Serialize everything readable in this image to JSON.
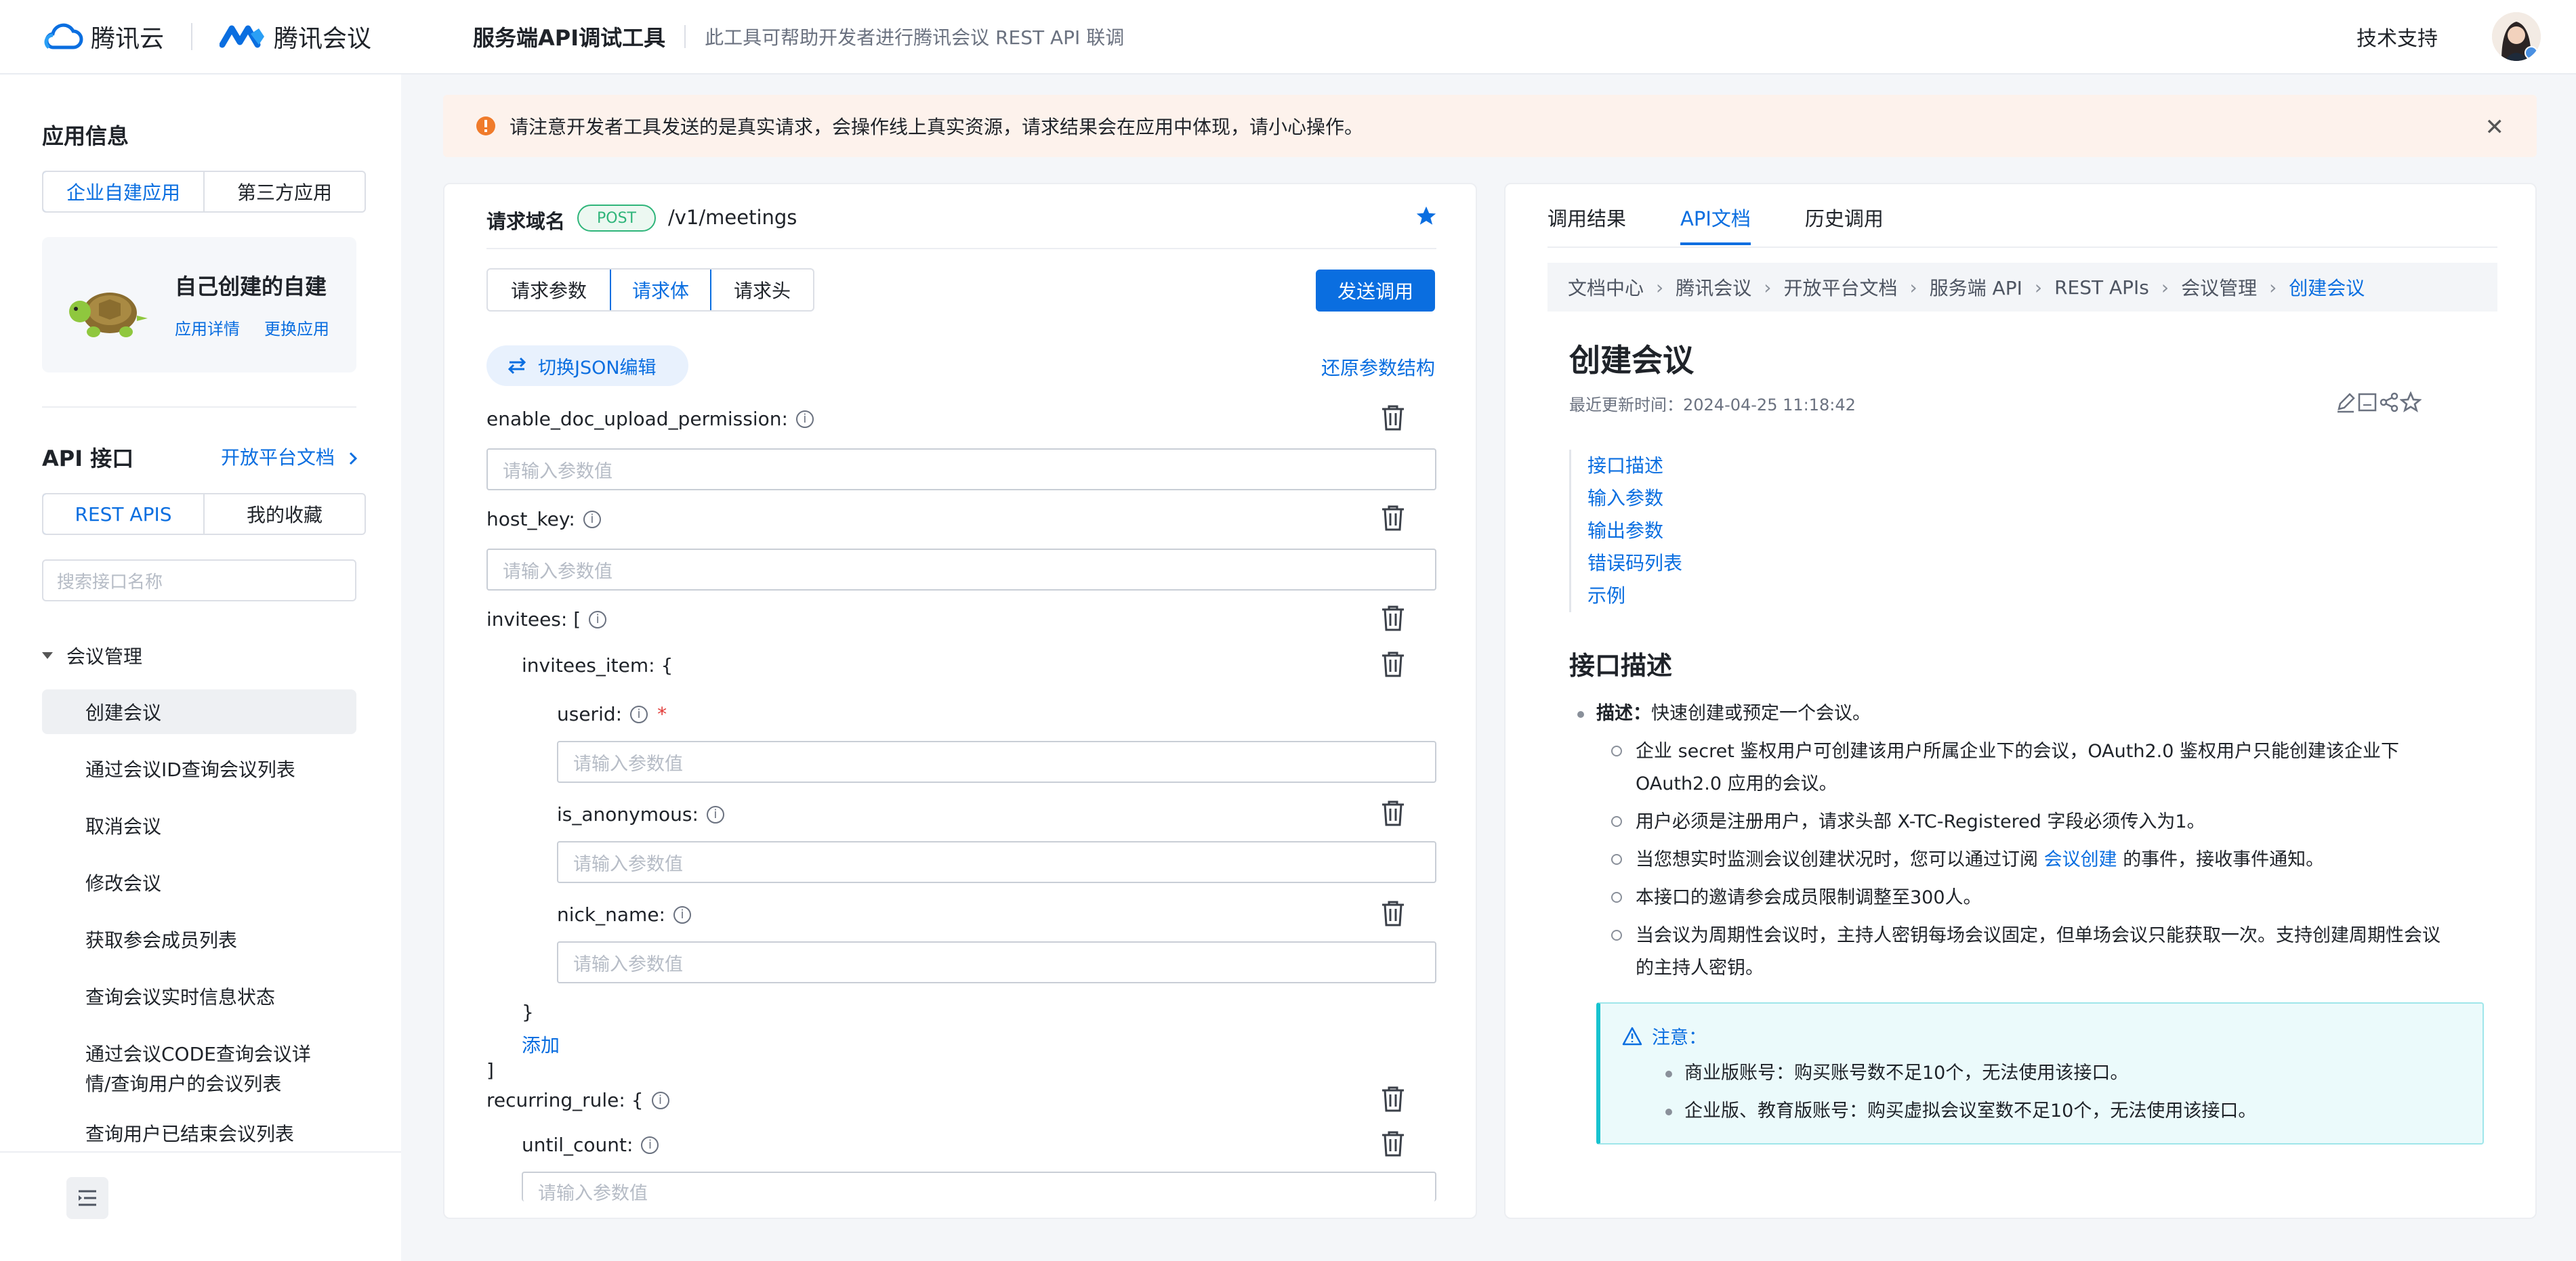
{
  "header": {
    "brand1": "腾讯云",
    "brand2": "腾讯会议",
    "tool_title": "服务端API调试工具",
    "tool_desc": "此工具可帮助开发者进行腾讯会议 REST API 联调",
    "support": "技术支持"
  },
  "sidebar": {
    "app_info_title": "应用信息",
    "app_tabs": [
      "企业自建应用",
      "第三方应用"
    ],
    "app_card": {
      "name": "自己创建的自建",
      "detail_link": "应用详情",
      "change_link": "更换应用"
    },
    "api_title": "API 接口",
    "platform_doc_link": "开放平台文档",
    "api_tabs": [
      "REST APIS",
      "我的收藏"
    ],
    "search_placeholder": "搜索接口名称",
    "group": "会议管理",
    "items": [
      "创建会议",
      "通过会议ID查询会议列表",
      "取消会议",
      "修改会议",
      "获取参会成员列表",
      "查询会议实时信息状态",
      "通过会议CODE查询会议详",
      "情/查询用户的会议列表",
      "查询用户已结束会议列表"
    ]
  },
  "alert": {
    "text": "请注意开发者工具发送的是真实请求，会操作线上真实资源，请求结果会在应用中体现，请小心操作。",
    "close": "✕"
  },
  "request": {
    "domain_label": "请求域名",
    "method": "POST",
    "path": "/v1/meetings",
    "tabs": [
      "请求参数",
      "请求体",
      "请求头"
    ],
    "send": "发送调用",
    "json_toggle": "切换JSON编辑",
    "restore": "还原参数结构",
    "placeholder": "请输入参数值",
    "fields": {
      "enable_doc": "enable_doc_upload_permission:",
      "host_key": "host_key:",
      "invitees": "invitees: [",
      "invitees_item": "invitees_item: {",
      "userid": "userid:",
      "is_anonymous": "is_anonymous:",
      "nick_name": "nick_name:",
      "close_brace": "}",
      "add": "添加",
      "close_bracket": "]",
      "recurring_rule": "recurring_rule: {",
      "until_count": "until_count:"
    },
    "required_mark": "*",
    "info_glyph": "i"
  },
  "doc": {
    "tabs": [
      "调用结果",
      "API文档",
      "历史调用"
    ],
    "breadcrumbs": [
      "文档中心",
      "腾讯会议",
      "开放平台文档",
      "服务端 API",
      "REST APIs",
      "会议管理",
      "创建会议"
    ],
    "breadcrumb_sep": "›",
    "title": "创建会议",
    "updated": "最近更新时间：2024-04-25 11:18:42",
    "toc": [
      "接口描述",
      "输入参数",
      "输出参数",
      "错误码列表",
      "示例"
    ],
    "section_title": "接口描述",
    "desc_label": "描述：",
    "desc_text": "快速创建或预定一个会议。",
    "bullets": {
      "b1_line1": "企业 secret 鉴权用户可创建该用户所属企业下的会议，OAuth2.0 鉴权用户只能创建该企业下",
      "b1_line2": "OAuth2.0 应用的会议。",
      "b2": "用户必须是注册用户，请求头部 X-TC-Registered 字段必须传入为1。",
      "b3_before": "当您想实时监测会议创建状况时，您可以通过订阅",
      "b3_link": "会议创建",
      "b3_after": "的事件，接收事件通知。",
      "b4": "本接口的邀请参会成员限制调整至300人。",
      "b5_line1": "当会议为周期性会议时，主持人密钥每场会议固定，但单场会议只能获取一次。支持创建周期性会议",
      "b5_line2": "的主持人密钥。"
    },
    "notice_title": "注意：",
    "notice_items": [
      "商业版账号：购买账号数不足10个，无法使用该接口。",
      "企业版、教育版账号：购买虚拟会议室数不足10个，无法使用该接口。"
    ]
  },
  "colors": {
    "primary": "#0a6ee0",
    "post": "#2fb57a",
    "warning": "#f07b2b",
    "notice_border": "#17c3cf"
  }
}
